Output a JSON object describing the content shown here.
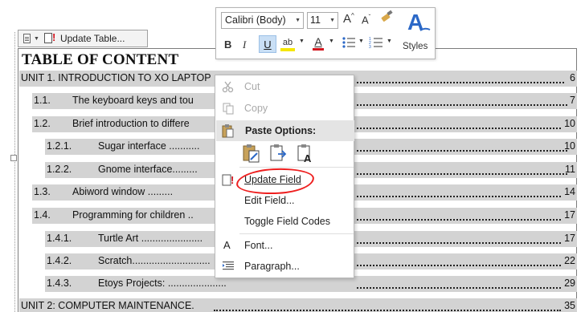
{
  "field_bar": {
    "label": "Update Table..."
  },
  "toc": {
    "title": "TABLE OF CONTENT",
    "entries": [
      {
        "num": "",
        "text": "UNIT 1. INTRODUCTION TO XO LAPTOP",
        "page": "6"
      },
      {
        "num": "1.1.",
        "text": "The keyboard keys and tou",
        "page": "7"
      },
      {
        "num": "1.2.",
        "text": "Brief introduction to differe",
        "page": "10"
      },
      {
        "num": "1.2.1.",
        "text": "Sugar interface ...........",
        "page": "10"
      },
      {
        "num": "1.2.2.",
        "text": "Gnome interface.........",
        "page": "11"
      },
      {
        "num": "1.3.",
        "text": "Abiword window .........",
        "page": "14"
      },
      {
        "num": "1.4.",
        "text": "Programming for children ..",
        "page": "17"
      },
      {
        "num": "1.4.1.",
        "text": "Turtle Art ......................",
        "page": "17"
      },
      {
        "num": "1.4.2.",
        "text": "Scratch............................",
        "page": "22"
      },
      {
        "num": "1.4.3.",
        "text": "Etoys Projects: .....................",
        "page": "29"
      },
      {
        "num": "",
        "text": "UNIT 2: COMPUTER MAINTENANCE.",
        "page": "35"
      }
    ]
  },
  "mini_toolbar": {
    "font_name": "Calibri (Body)",
    "font_size": "11",
    "bold": "B",
    "italic": "I",
    "underline": "U",
    "highlight_label": "ab",
    "font_color_label": "A",
    "styles_label": "Styles"
  },
  "context_menu": {
    "cut": "Cut",
    "copy": "Copy",
    "paste_options": "Paste Options:",
    "update_field": "Update Field",
    "edit_field": "Edit Field...",
    "toggle_field_codes": "Toggle Field Codes",
    "font": "Font...",
    "paragraph": "Paragraph..."
  },
  "colors": {
    "field_shading": "#d3d3d3",
    "highlight_oval": "#ee1f1f",
    "underline_active": "#c9dff5"
  }
}
